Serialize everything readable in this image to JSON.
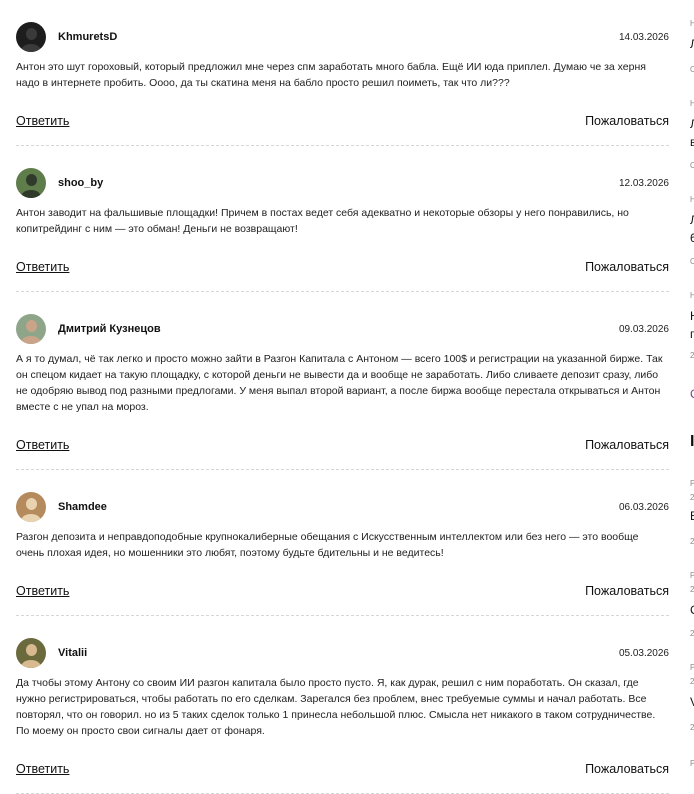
{
  "comments": [
    {
      "author": "KhmuretsD",
      "date": "14.03.2026",
      "text": "Антон это шут гороховый, который предложил мне через спм заработать много бабла. Ещё ИИ юда приплел. Думаю че за херня надо в интернете пробить. Оооо, да ты скатина меня на бабло просто решил поиметь, так что ли???",
      "reply_label": "Ответить",
      "report_label": "Пожаловаться",
      "avatar_colors": [
        "#1d1d1d",
        "#3a3a3a"
      ]
    },
    {
      "author": "shoo_by",
      "date": "12.03.2026",
      "text": "Антон заводит на фальшивые площадки! Причем в постах ведет себя адекватно и некоторые обзоры у него понравились, но копитрейдинг с ним — это обман! Деньги не возвращают!",
      "reply_label": "Ответить",
      "report_label": "Пожаловаться",
      "avatar_colors": [
        "#5e7d4a",
        "#2f3a2a"
      ]
    },
    {
      "author": "Дмитрий Кузнецов",
      "date": "09.03.2026",
      "text": "А я то думал, чё так легко и просто можно зайти в Разгон Капитала с Антоном — всего 100$ и регистрации на указанной бирже. Так он спецом кидает на такую площадку, с которой деньги не вывести да и вообще не заработать. Либо сливаете депозит сразу, либо не одобряю вывод под разными предлогами. У меня выпал второй вариант, а после биржа вообще перестала открываться и Антон вместе с не упал на мороз.",
      "reply_label": "Ответить",
      "report_label": "Пожаловаться",
      "avatar_colors": [
        "#8fa58a",
        "#c9a489"
      ]
    },
    {
      "author": "Shamdee",
      "date": "06.03.2026",
      "text": "Разгон депозита и неправдоподобные крупнокалиберные обещания с Искусственным интеллектом или без него — это вообще очень плохая идея, но мошенники это любят, поэтому будьте бдительны и не ведитесь!",
      "reply_label": "Ответить",
      "report_label": "Пожаловаться",
      "avatar_colors": [
        "#b58a5c",
        "#e8d2b0"
      ]
    },
    {
      "author": "Vitalii",
      "date": "05.03.2026",
      "text": "Да тчобы этому Антону со своим ИИ разгон капитала было просто пусто. Я, как дурак, решил с ним поработать. Он сказал, где нужно регистрироваться, чтобы работать по его сделкам. Зарегался без проблем, внес требуемые суммы и начал работать. Все повторял, что он говорил. но из 5 таких сделок только 1 принесла небольшой плюс. Смысла нет никакого в таком сотрудничестве. По моему он просто свои сигналы дает от фонаря.",
      "reply_label": "Ответить",
      "report_label": "Пожаловаться",
      "avatar_colors": [
        "#6b6a3c",
        "#d9b98f"
      ]
    }
  ],
  "sidebar_fragments": [
    {
      "text": "Н",
      "cls": "small"
    },
    {
      "text": "Л",
      "cls": ""
    },
    {
      "text": "С",
      "cls": "small"
    },
    {
      "text": "Н",
      "cls": "small"
    },
    {
      "text": "Л",
      "cls": ""
    },
    {
      "text": "в",
      "cls": ""
    },
    {
      "text": "С",
      "cls": "small"
    },
    {
      "text": "Н",
      "cls": "small"
    },
    {
      "text": "Л",
      "cls": ""
    },
    {
      "text": "6",
      "cls": ""
    },
    {
      "text": "С",
      "cls": "small"
    },
    {
      "text": "Н",
      "cls": "small"
    },
    {
      "text": "Н",
      "cls": ""
    },
    {
      "text": "г",
      "cls": ""
    },
    {
      "text": "2",
      "cls": "small"
    },
    {
      "text": "С",
      "cls": "accent"
    },
    {
      "text": "I",
      "cls": "big"
    },
    {
      "text": "Р",
      "cls": "small"
    },
    {
      "text": "2",
      "cls": "small"
    },
    {
      "text": "Е",
      "cls": ""
    },
    {
      "text": "2",
      "cls": "small"
    },
    {
      "text": "Р",
      "cls": "small"
    },
    {
      "text": "2",
      "cls": "small"
    },
    {
      "text": "С",
      "cls": ""
    },
    {
      "text": "2",
      "cls": "small"
    },
    {
      "text": "Р",
      "cls": "small"
    },
    {
      "text": "2",
      "cls": "small"
    },
    {
      "text": "V",
      "cls": ""
    },
    {
      "text": "2",
      "cls": "small"
    },
    {
      "text": "Р",
      "cls": "small"
    }
  ]
}
